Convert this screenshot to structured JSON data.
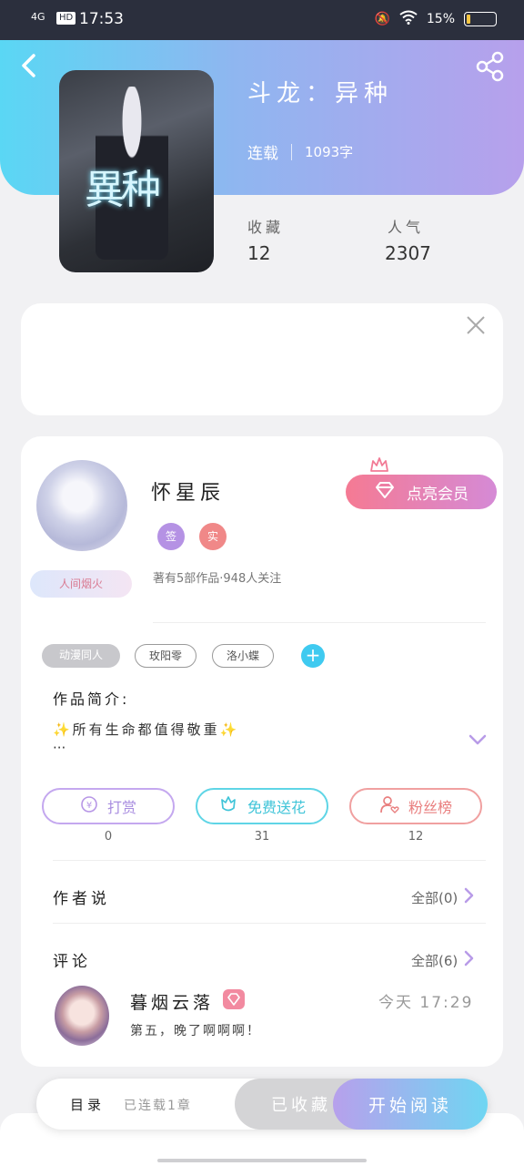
{
  "status_bar": {
    "network": "4G",
    "hd": "HD",
    "time": "17:53",
    "battery": "15%"
  },
  "book": {
    "title": "斗龙：异种",
    "serial_status": "连载",
    "word_count": "1093字",
    "favorites_label": "收藏",
    "favorites_value": "12",
    "popularity_label": "人气",
    "popularity_value": "2307"
  },
  "author": {
    "name": "怀星辰",
    "badge_text": "人间烟火",
    "tag1": "签",
    "tag2": "实",
    "meta": "著有5部作品·948人关注",
    "vip_button": "点亮会员"
  },
  "tags": [
    "动漫同人",
    "玫阳零",
    "洛小蝶"
  ],
  "intro": {
    "label": "作品简介:",
    "text": "✨所有生命都值得敬重✨",
    "more": "···"
  },
  "actions": [
    {
      "label": "打赏",
      "count": "0",
      "color": "#b991e6"
    },
    {
      "label": "免费送花",
      "count": "31",
      "color": "#45cde0"
    },
    {
      "label": "粉丝榜",
      "count": "12",
      "color": "#ef8a8a"
    }
  ],
  "author_says": {
    "title": "作者说",
    "link": "全部(0)"
  },
  "comments": {
    "title": "评论",
    "link": "全部(6)",
    "items": [
      {
        "user": "暮烟云落",
        "time": "今天 17:29",
        "text": "第五，晚了啊啊啊！"
      }
    ]
  },
  "bottom": {
    "toc": "目录",
    "toc_status": "已连载1章",
    "favorited": "已收藏",
    "start_reading": "开始阅读"
  }
}
